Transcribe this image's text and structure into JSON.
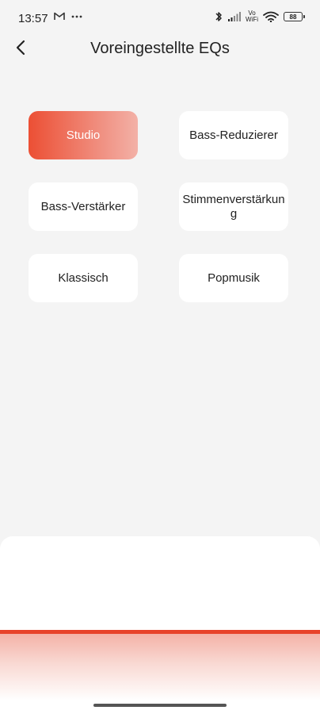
{
  "status_bar": {
    "time": "13:57",
    "left_icons": [
      "gmail-icon",
      "more-dots-icon"
    ],
    "volte_top": "Vo",
    "volte_bottom": "WiFi",
    "battery": "88"
  },
  "header": {
    "title": "Voreingestellte EQs",
    "back_icon": "chevron-left-icon"
  },
  "presets": [
    {
      "label": "Studio",
      "active": true
    },
    {
      "label": "Bass-Reduzierer",
      "active": false
    },
    {
      "label": "Bass-Verstärker",
      "active": false
    },
    {
      "label": "Stimmenverstärkung",
      "active": false
    },
    {
      "label": "Klassisch",
      "active": false
    },
    {
      "label": "Popmusik",
      "active": false
    }
  ],
  "colors": {
    "accent": "#e8432a",
    "active_gradient_start": "#ec4f34",
    "active_gradient_end": "#f3b1a7",
    "background": "#f4f4f4",
    "card": "#ffffff"
  }
}
